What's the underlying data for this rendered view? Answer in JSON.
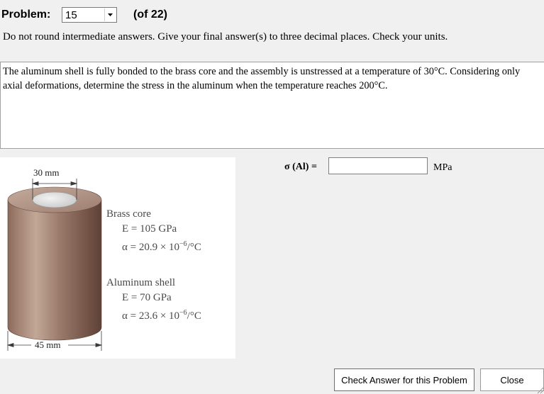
{
  "header": {
    "problem_label": "Problem:",
    "problem_number": "15",
    "of_total": "(of 22)"
  },
  "instructions": "Do not round intermediate answers.  Give your final answer(s) to three decimal places.  Check your units.",
  "statement": {
    "line1": "The aluminum shell is fully bonded to the brass core and the assembly is unstressed at a temperature of 30°C.  Considering only",
    "line2": "axial deformations, determine the stress in the aluminum when the temperature reaches 200°C."
  },
  "figure": {
    "core_dim": "30 mm",
    "shell_dim": "45 mm",
    "brass": {
      "title": "Brass core",
      "E": "E = 105 GPa",
      "alpha": "α = 20.9 × 10",
      "alpha_exp": "−6",
      "alpha_unit": "/°C"
    },
    "aluminum": {
      "title": "Aluminum shell",
      "E": "E = 70 GPa",
      "alpha": "α = 23.6 × 10",
      "alpha_exp": "−6",
      "alpha_unit": "/°C"
    }
  },
  "answer": {
    "label": "σ (Al) =",
    "value": "",
    "unit": "MPa"
  },
  "buttons": {
    "check": "Check Answer for this Problem",
    "close": "Close"
  }
}
